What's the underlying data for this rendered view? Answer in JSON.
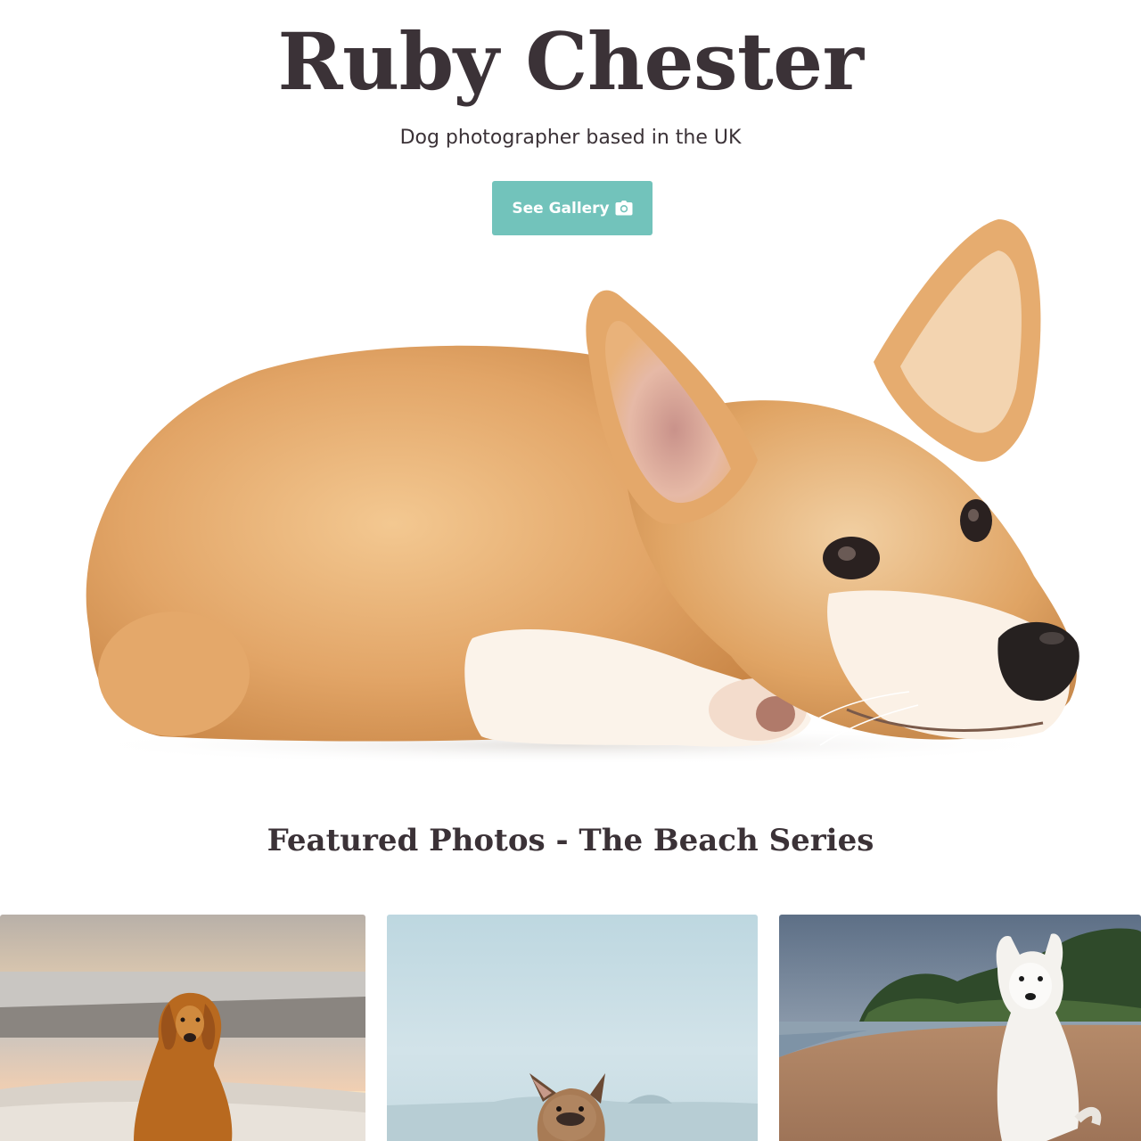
{
  "header": {
    "title": "Ruby Chester",
    "tagline": "Dog photographer based in the UK",
    "cta_label": "See Gallery",
    "cta_icon": "camera-icon",
    "accent_color": "#72c3bb"
  },
  "hero": {
    "image": "corgi-lying-down-photo"
  },
  "featured": {
    "title": "Featured Photos - The Beach Series",
    "photos": [
      {
        "image": "golden-retriever-beach-sunset-photo"
      },
      {
        "image": "french-bulldog-beach-photo"
      },
      {
        "image": "white-shepherd-beach-photo"
      }
    ]
  }
}
